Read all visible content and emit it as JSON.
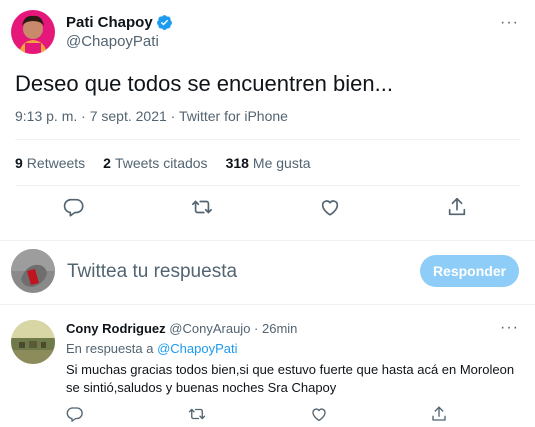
{
  "tweet": {
    "author_name": "Pati Chapoy",
    "author_handle": "@ChapoyPati",
    "text": "Deseo que todos se encuentren bien...",
    "time": "9:13 p. m.",
    "date": "7 sept. 2021",
    "source": "Twitter for iPhone",
    "separator": " · ",
    "stats": {
      "retweets_count": "9",
      "retweets_label": "Retweets",
      "quotes_count": "2",
      "quotes_label": "Tweets citados",
      "likes_count": "318",
      "likes_label": "Me gusta"
    },
    "more_label": "···"
  },
  "reply_composer": {
    "placeholder": "Twittea tu respuesta",
    "button_label": "Responder"
  },
  "reply": {
    "author_name": "Cony Rodriguez",
    "author_handle": "@ConyAraujo",
    "time": "26min",
    "separator": " · ",
    "replying_prefix": "En respuesta a ",
    "replying_to": "@ChapoyPati",
    "text": "Si muchas gracias todos bien,si que estuvo fuerte que hasta acá en Moroleon se sintió,saludos y buenas noches Sra Chapoy",
    "more_label": "···"
  },
  "colors": {
    "accent": "#1d9bf0",
    "button_disabled": "#8ecdf7",
    "secondary_text": "#536471",
    "divider": "#eff3f4"
  },
  "icons": [
    "verified-badge-icon",
    "reply-icon",
    "retweet-icon",
    "like-icon",
    "share-icon",
    "more-icon"
  ]
}
